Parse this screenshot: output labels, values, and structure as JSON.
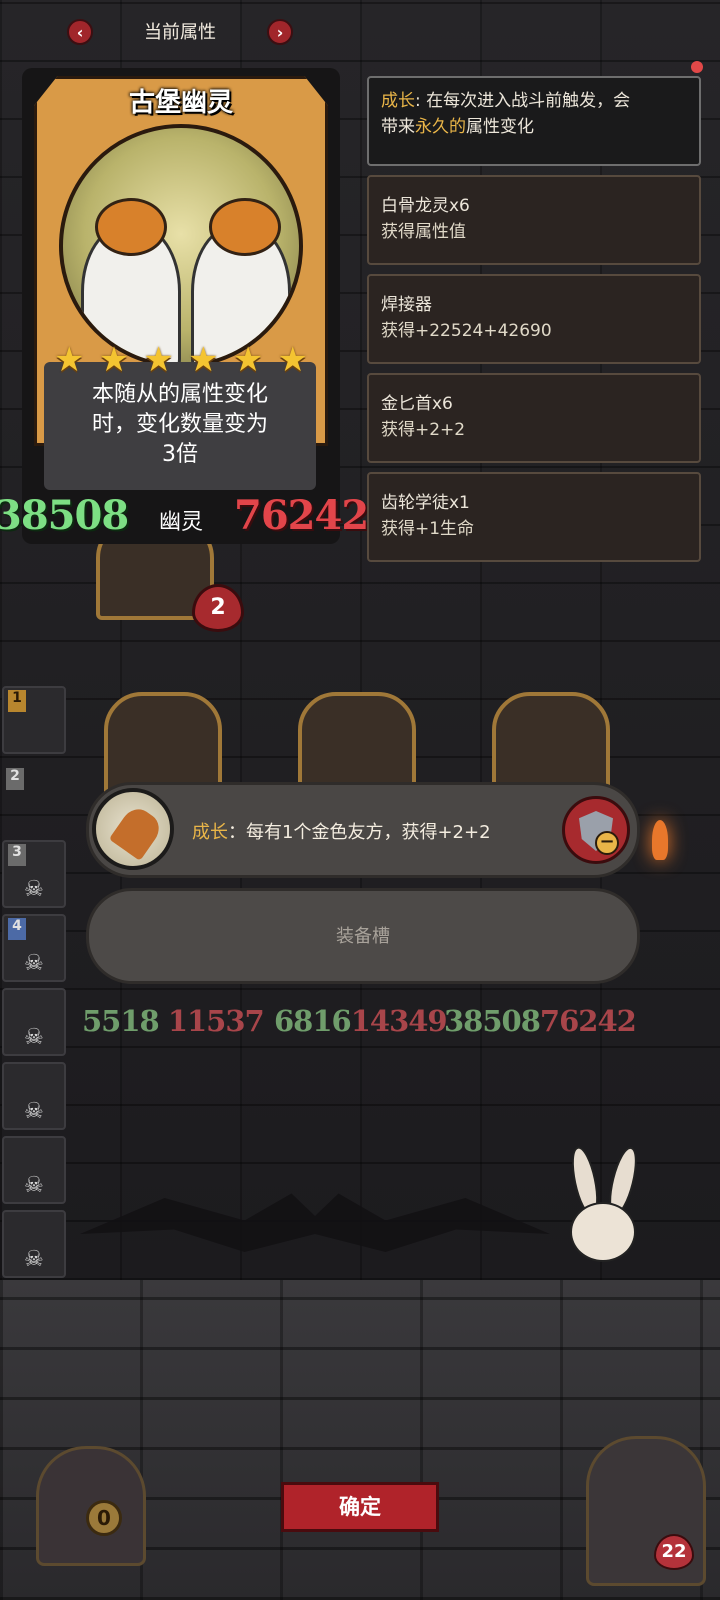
{
  "header": {
    "title": "当前属性"
  },
  "hero_card": {
    "name": "古堡幽灵",
    "stars": 6,
    "description_lines": [
      "本随从的属性变化",
      "时，变化数量变为",
      "3倍"
    ],
    "attack": "38508",
    "health": "76242",
    "type": "幽灵"
  },
  "attributes": [
    {
      "prefix": "成长",
      "text_a": ": 在每次进入战斗前触发，会",
      "text_b_pre": "带来",
      "text_b_gold": "永久的",
      "text_b_post": "属性变化"
    },
    {
      "title": "白骨龙灵x6",
      "detail": "获得属性值"
    },
    {
      "title": "焊接器",
      "detail": "获得+22524+42690"
    },
    {
      "title": "金匕首x6",
      "detail": "获得+2+2"
    },
    {
      "title": "齿轮学徒x1",
      "detail": "获得+1生命"
    }
  ],
  "side_rail": [
    "1",
    "2",
    "3",
    "4"
  ],
  "selected_unit_level": "2",
  "skill": {
    "label": "成长",
    "text": "：每有1个金色友方，获得+2+2"
  },
  "equip_slot": {
    "label": "装备槽"
  },
  "board_stats": [
    {
      "atk": "5518",
      "hp": "11537"
    },
    {
      "atk": "6816",
      "hp": "14349"
    },
    {
      "atk": "38508",
      "hp": "76242"
    }
  ],
  "confirm_label": "确定",
  "bottom_left_count": "0",
  "bottom_right_health": "22"
}
